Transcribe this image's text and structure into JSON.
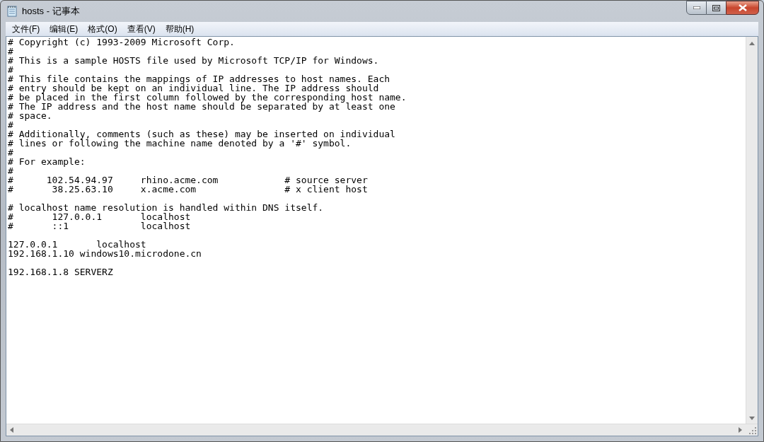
{
  "window": {
    "title": "hosts - 记事本"
  },
  "menu": [
    {
      "label": "文件(F)"
    },
    {
      "label": "编辑(E)"
    },
    {
      "label": "格式(O)"
    },
    {
      "label": "查看(V)"
    },
    {
      "label": "帮助(H)"
    }
  ],
  "document": {
    "text": "# Copyright (c) 1993-2009 Microsoft Corp.\n#\n# This is a sample HOSTS file used by Microsoft TCP/IP for Windows.\n#\n# This file contains the mappings of IP addresses to host names. Each\n# entry should be kept on an individual line. The IP address should\n# be placed in the first column followed by the corresponding host name.\n# The IP address and the host name should be separated by at least one\n# space.\n#\n# Additionally, comments (such as these) may be inserted on individual\n# lines or following the machine name denoted by a '#' symbol.\n#\n# For example:\n#\n#      102.54.94.97     rhino.acme.com            # source server\n#       38.25.63.10     x.acme.com                # x client host\n\n# localhost name resolution is handled within DNS itself.\n#       127.0.0.1       localhost\n#       ::1             localhost\n\n127.0.0.1       localhost\n192.168.1.10 windows10.microdone.cn\n\n192.168.1.8 SERVERZ"
  }
}
